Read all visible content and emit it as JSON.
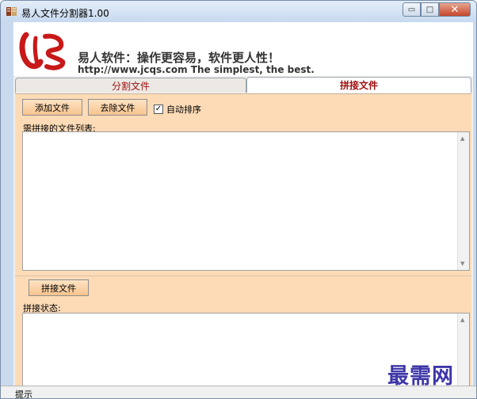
{
  "window": {
    "title": "易人文件分割器1.00",
    "controls": {
      "minimize": "▭",
      "maximize": "□",
      "close": "✕"
    }
  },
  "banner": {
    "logo_icon": "red-brush-logo-icon",
    "slogan": "易人软件：操作更容易，软件更人性！",
    "url_line": "http://www.jcqs.com  The simplest, the best."
  },
  "tabs": [
    {
      "label": "分割文件",
      "active": false
    },
    {
      "label": "拼接文件",
      "active": true
    }
  ],
  "panel": {
    "add_button": "添加文件",
    "remove_button": "去除文件",
    "auto_sort": {
      "label": "自动排序",
      "checked": true,
      "mark": "✓"
    },
    "file_list_label": "需拼接的文件列表:",
    "join_button": "拼接文件",
    "status_label": "拼接状态:"
  },
  "statusbar": {
    "text": "提示"
  },
  "watermark": "最需网",
  "colors": {
    "panel": "#fddbb6",
    "button": "#f8c48e",
    "tab_text": "#a01010",
    "watermark": "#3e36a8"
  }
}
